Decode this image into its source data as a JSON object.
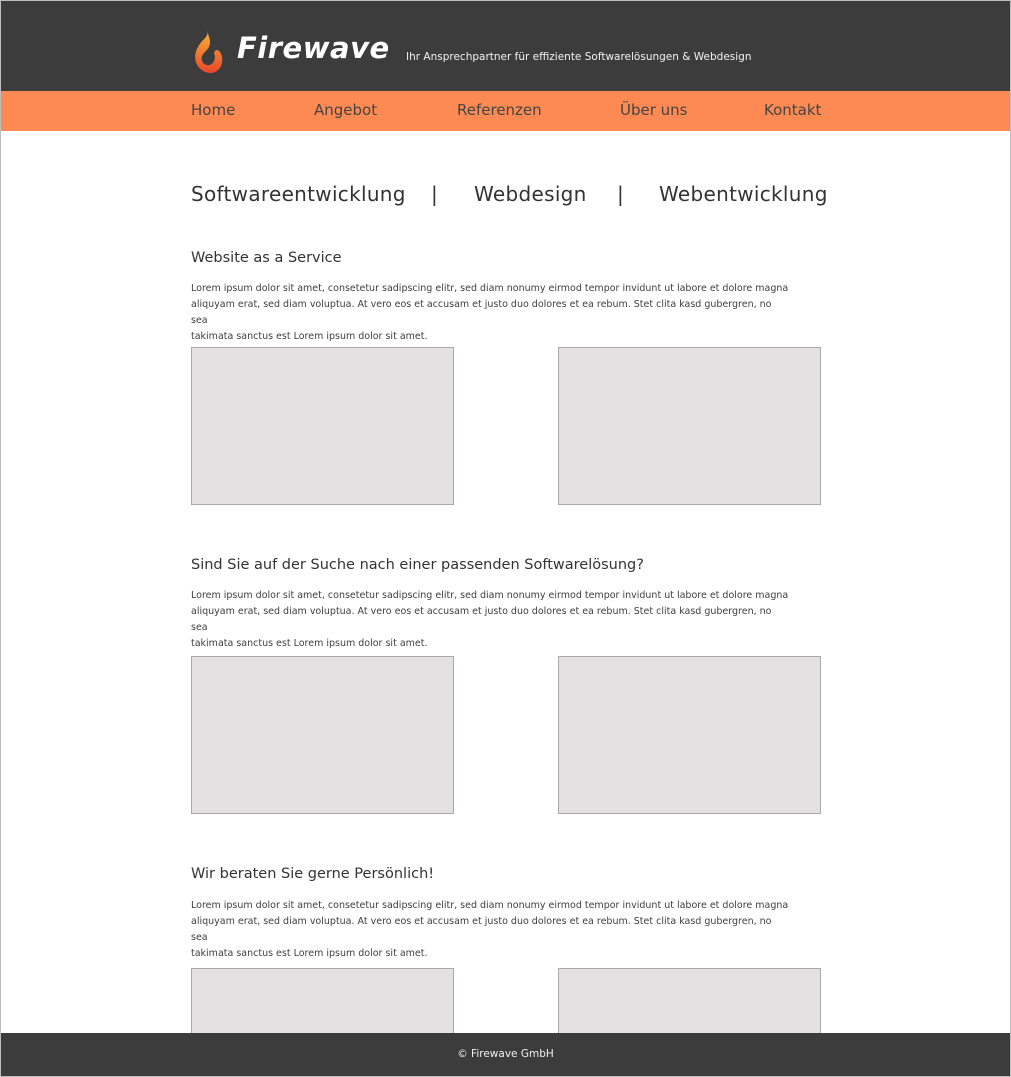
{
  "header": {
    "brand": "Firewave",
    "tagline": "Ihr Ansprechpartner für effiziente Softwarelösungen & Webdesign",
    "logo_icon": "flame-logo-icon",
    "colors": {
      "background": "#3c3c3c",
      "flame_orange": "#f5a623",
      "flame_red": "#e8472b"
    }
  },
  "nav": {
    "color": "#fd8a52",
    "items": [
      {
        "label": "Home"
      },
      {
        "label": "Angebot"
      },
      {
        "label": "Referenzen"
      },
      {
        "label": "Über uns"
      },
      {
        "label": "Kontakt"
      }
    ]
  },
  "services": {
    "items": [
      "Softwareentwicklung",
      "Webdesign",
      "Webentwicklung"
    ],
    "separator": "|"
  },
  "sections": [
    {
      "title": "Website as a Service",
      "text_lines": [
        "Lorem ipsum dolor sit amet, consetetur sadipscing elitr, sed diam nonumy eirmod tempor invidunt ut labore et dolore magna",
        "aliquyam erat, sed diam voluptua. At vero eos et accusam et justo duo dolores et ea rebum. Stet clita kasd gubergren, no sea",
        "takimata sanctus est Lorem ipsum dolor sit amet."
      ]
    },
    {
      "title": "Sind Sie auf der Suche nach einer passenden Softwarelösung?",
      "text_lines": [
        "Lorem ipsum dolor sit amet, consetetur sadipscing elitr, sed diam nonumy eirmod tempor invidunt ut labore et dolore magna",
        "aliquyam erat, sed diam voluptua. At vero eos et accusam et justo duo dolores et ea rebum. Stet clita kasd gubergren, no sea",
        "takimata sanctus est Lorem ipsum dolor sit amet."
      ]
    },
    {
      "title": "Wir beraten Sie gerne Persönlich!",
      "text_lines": [
        "Lorem ipsum dolor sit amet, consetetur sadipscing elitr, sed diam nonumy eirmod tempor invidunt ut labore et dolore magna",
        "aliquyam erat, sed diam voluptua. At vero eos et accusam et justo duo dolores et ea rebum. Stet clita kasd gubergren, no sea",
        "takimata sanctus est Lorem ipsum dolor sit amet."
      ]
    }
  ],
  "footer": {
    "copyright": "© Firewave GmbH"
  }
}
